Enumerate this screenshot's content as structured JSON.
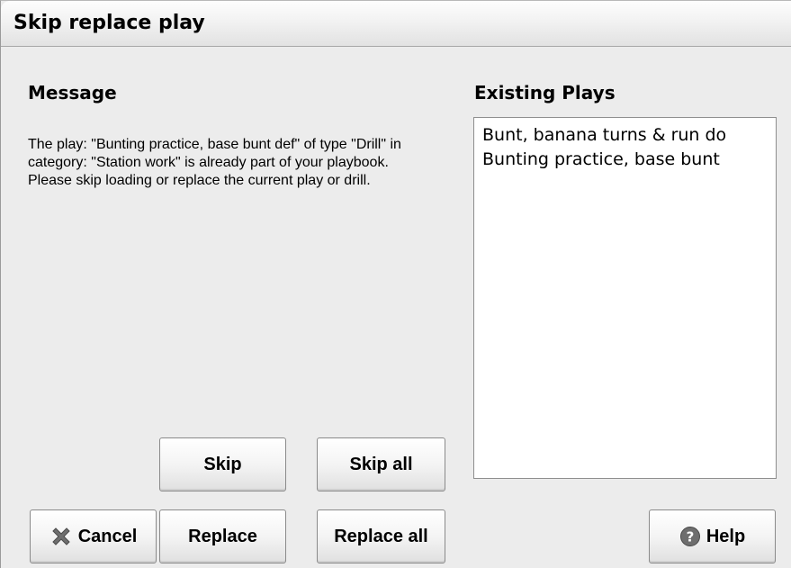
{
  "window": {
    "title": "Skip replace play"
  },
  "message": {
    "heading": "Message",
    "text": "The play: \"Bunting practice, base bunt def\" of type \"Drill\" in category: \"Station work\" is already part of your playbook.\nPlease skip loading or replace the current play or drill."
  },
  "existing": {
    "heading": "Existing Plays",
    "items": [
      "Bunt, banana turns & run do",
      "Bunting practice, base bunt"
    ]
  },
  "buttons": {
    "skip": "Skip",
    "skip_all": "Skip all",
    "cancel": "Cancel",
    "replace": "Replace",
    "replace_all": "Replace all",
    "help": "Help"
  },
  "icons": {
    "cancel": "close-x-icon",
    "help": "question-circle-icon"
  },
  "colors": {
    "dialog_bg": "#ececec",
    "list_bg": "#ffffff",
    "cancel_icon": "#6e6e6e",
    "help_icon": "#6e6e6e"
  }
}
